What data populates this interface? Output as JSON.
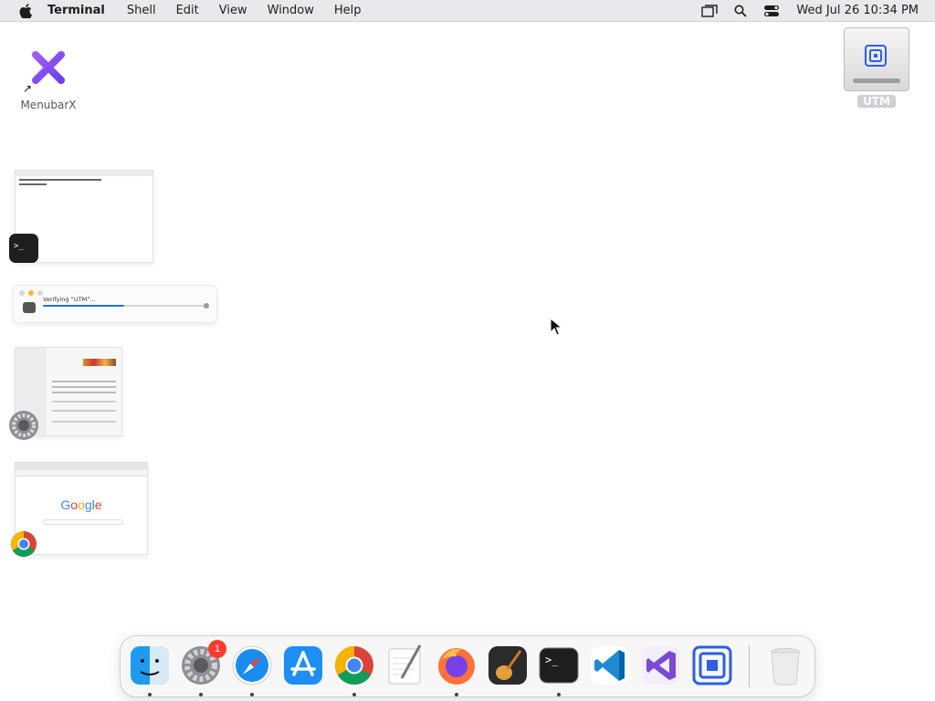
{
  "menubar": {
    "app_name": "Terminal",
    "items": [
      "Shell",
      "Edit",
      "View",
      "Window",
      "Help"
    ],
    "clock": "Wed Jul 26  10:34 PM",
    "status_icons": [
      "display-icon",
      "search-icon",
      "control-center-icon"
    ]
  },
  "desktop": {
    "menubarx_label": "MenubarX",
    "utm_label": "UTM"
  },
  "stage_manager": {
    "verify_text": "Verifying “UTM”...",
    "verify_progress": 0.5,
    "google_text": "Google"
  },
  "dock": {
    "items": [
      {
        "name": "finder",
        "running": true
      },
      {
        "name": "system-settings",
        "running": true,
        "badge": "1"
      },
      {
        "name": "safari",
        "running": true
      },
      {
        "name": "app-store",
        "running": false
      },
      {
        "name": "chrome",
        "running": true
      },
      {
        "name": "textedit",
        "running": false
      },
      {
        "name": "firefox",
        "running": true
      },
      {
        "name": "garageband",
        "running": false
      },
      {
        "name": "terminal",
        "running": true
      },
      {
        "name": "vscode",
        "running": false
      },
      {
        "name": "visual-studio",
        "running": false
      },
      {
        "name": "utm",
        "running": false
      },
      {
        "name": "trash",
        "running": false
      }
    ]
  },
  "colors": {
    "menubar_bg": "#e9e9eb",
    "accent_blue": "#1d76e2",
    "badge_red": "#ff3b30"
  }
}
